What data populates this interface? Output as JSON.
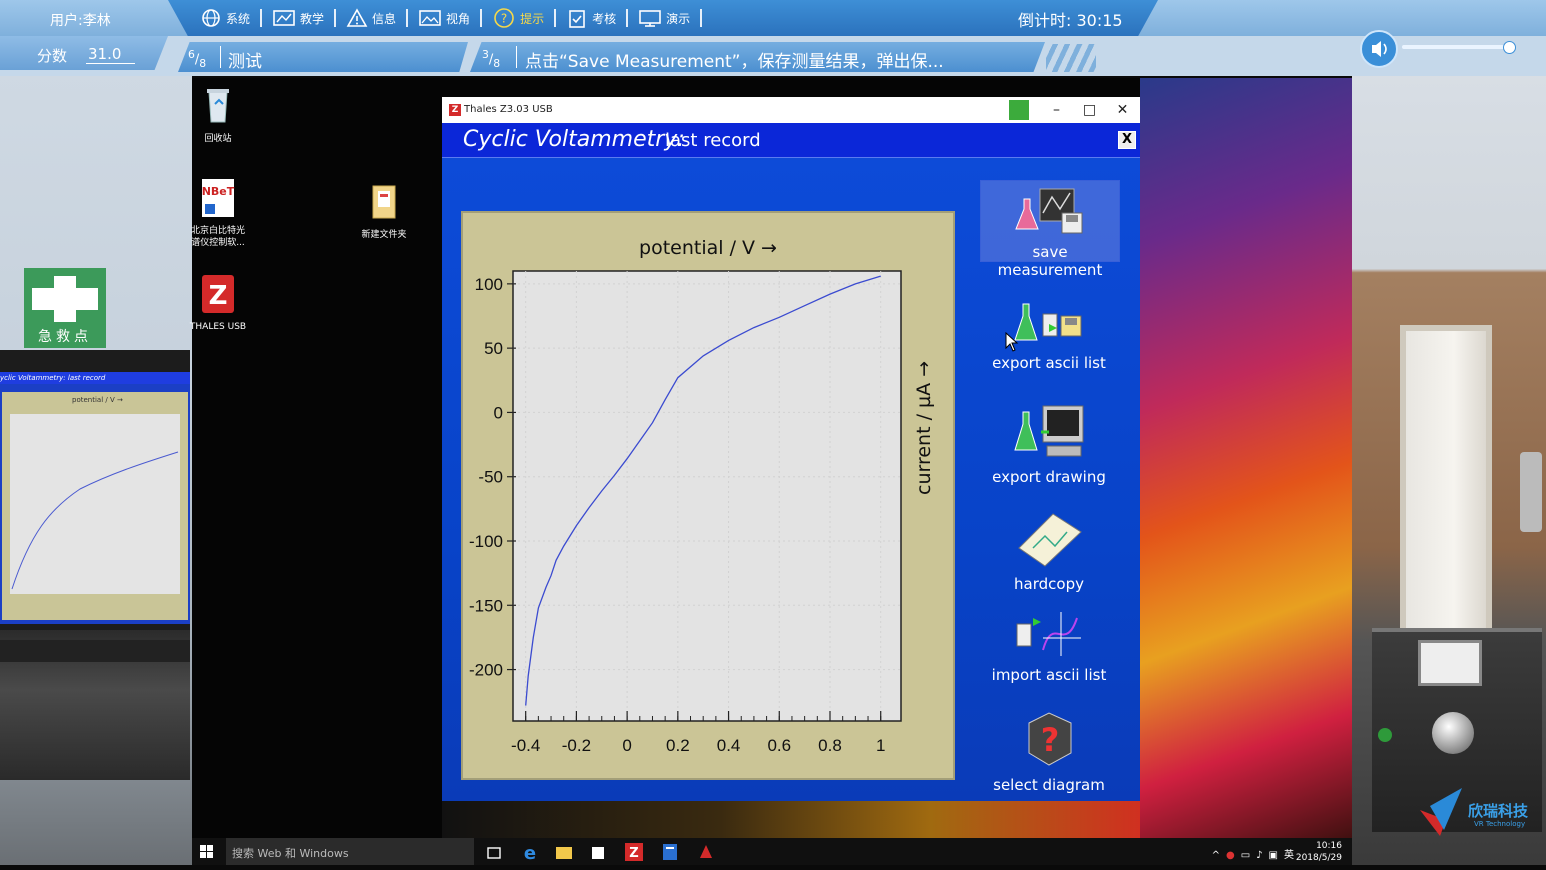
{
  "training_bar": {
    "user": "用户:李林",
    "score_label": "分数",
    "score_value": "31.0",
    "menu": [
      {
        "label": "系统",
        "icon": "globe-icon"
      },
      {
        "label": "教学",
        "icon": "teach-icon"
      },
      {
        "label": "信息",
        "icon": "warning-icon"
      },
      {
        "label": "视角",
        "icon": "picture-icon"
      },
      {
        "label": "提示",
        "icon": "help-icon"
      },
      {
        "label": "考核",
        "icon": "clipboard-icon"
      },
      {
        "label": "演示",
        "icon": "monitor-icon"
      }
    ],
    "countdown": "倒计时: 30:15"
  },
  "steps": {
    "module_num": "6",
    "module_den": "8",
    "module_name": "测试",
    "step_num": "3",
    "step_den": "8",
    "step_text": "点击“Save Measurement”，保存测量结果，弹出保..."
  },
  "volume": {
    "level": 1.0
  },
  "desktop": {
    "icons": [
      {
        "label": "回收站",
        "icon": "recycle-bin-icon"
      },
      {
        "label": "北京白比特光谱仪控制软...",
        "icon": "nbet-app-icon"
      },
      {
        "label": "THALES USB",
        "icon": "thales-app-icon"
      },
      {
        "label": "新建文件夹",
        "icon": "folder-icon"
      }
    ]
  },
  "app": {
    "window_title": "Thales Z3.03 USB",
    "header_italic": "Cyclic Voltammetry:",
    "header_rest": "last record",
    "close_glyph": "X",
    "side_buttons": [
      {
        "label": "save measurement",
        "icon": "save-measurement-icon"
      },
      {
        "label": "export ascii list",
        "icon": "export-ascii-icon"
      },
      {
        "label": "export drawing",
        "icon": "export-drawing-icon"
      },
      {
        "label": "hardcopy",
        "icon": "hardcopy-icon"
      },
      {
        "label": "import ascii list",
        "icon": "import-ascii-icon"
      },
      {
        "label": "select diagram",
        "icon": "select-diagram-icon"
      }
    ]
  },
  "chart_data": {
    "type": "line",
    "title": "",
    "xlabel": "potential / V →",
    "ylabel": "current / µA →",
    "xlim": [
      -0.45,
      1.08
    ],
    "ylim": [
      -240,
      110
    ],
    "xticks": [
      "-0.4",
      "-0.2",
      "0",
      "0.2",
      "0.4",
      "0.6",
      "0.8",
      "1"
    ],
    "xtick_values": [
      -0.4,
      -0.2,
      0,
      0.2,
      0.4,
      0.6,
      0.8,
      1
    ],
    "yticks": [
      "100",
      "50",
      "0",
      "-50",
      "-100",
      "-150",
      "-200"
    ],
    "ytick_values": [
      100,
      50,
      0,
      -50,
      -100,
      -150,
      -200
    ],
    "grid": true,
    "series": [
      {
        "color": "#3b4bd0",
        "x": [
          -0.4,
          -0.39,
          -0.37,
          -0.35,
          -0.32,
          -0.3,
          -0.28,
          -0.25,
          -0.2,
          -0.15,
          -0.1,
          -0.05,
          0.0,
          0.05,
          0.1,
          0.15,
          0.2,
          0.3,
          0.4,
          0.5,
          0.6,
          0.7,
          0.8,
          0.9,
          1.0
        ],
        "y": [
          -228,
          -205,
          -175,
          -152,
          -136,
          -127,
          -115,
          -104,
          -88,
          -74,
          -61,
          -49,
          -36,
          -22,
          -8,
          10,
          27,
          44,
          56,
          66,
          74,
          83,
          92,
          100,
          106
        ]
      }
    ]
  },
  "taskbar": {
    "search_placeholder": "搜索 Web 和 Windows",
    "time": "10:16",
    "date": "2018/5/29",
    "lang": "英"
  },
  "scene": {
    "firstaid_text": "急救点",
    "bg_monitor_title": "yclic Voltammetry: last record",
    "bg_monitor_label": "potential / V →",
    "brand": "欣瑞科技",
    "brand_sub": "VR Technology"
  }
}
